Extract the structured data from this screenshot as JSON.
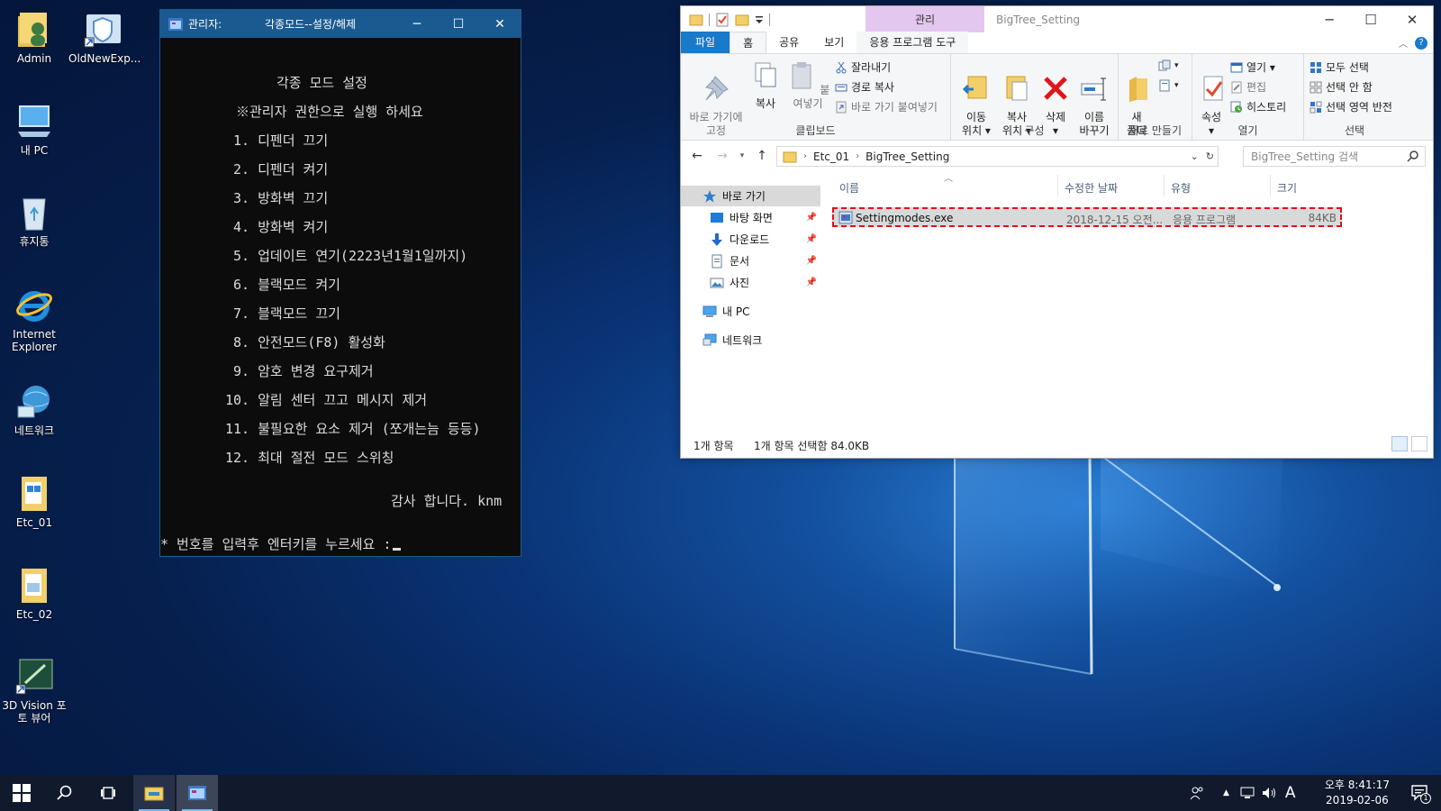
{
  "desktop": {
    "icons": [
      {
        "label": "Admin",
        "icon": "user-folder-icon"
      },
      {
        "label": "OldNewExp...",
        "icon": "shield-shortcut-icon"
      },
      {
        "label": "내 PC",
        "icon": "computer-icon"
      },
      {
        "label": "휴지통",
        "icon": "recycle-bin-icon"
      },
      {
        "label": "Internet Explorer",
        "icon": "internet-explorer-icon"
      },
      {
        "label": "네트워크",
        "icon": "network-icon"
      },
      {
        "label": "Etc_01",
        "icon": "folder-icon"
      },
      {
        "label": "Etc_02",
        "icon": "folder-icon"
      },
      {
        "label": "3D Vision 포토 뷰어",
        "icon": "3d-vision-icon"
      }
    ]
  },
  "console": {
    "title_admin": "관리자:",
    "title_main": "각종모드--설정/해제",
    "heading": "각종 모드 설정",
    "notice": "※관리자 권한으로 실행 하세요",
    "items": [
      "1. 디펜더 끄기",
      "2. 디펜더 켜기",
      "3. 방화벽 끄기",
      "4. 방화벽 켜기",
      "5. 업데이트 연기(2223년1월1일까지)",
      "6. 블랙모드 켜기",
      "7. 블랙모드 끄기",
      "8. 안전모드(F8) 활성화",
      "9. 암호 변경 요구제거",
      "10. 알림 센터 끄고 메시지 제거",
      "11. 불필요한 요소 제거 (쪼개는늠 등등)",
      "12. 최대 절전 모드 스위칭"
    ],
    "thanks": "감사 합니다. knm",
    "prompt": "* 번호를 입력후 엔터키를 누르세요 :"
  },
  "explorer": {
    "context_tab": "관리",
    "title": "BigTree_Setting",
    "tabs": {
      "file": "파일",
      "home": "홈",
      "share": "공유",
      "view": "보기",
      "app_tools": "응용 프로그램 도구"
    },
    "ribbon": {
      "pin_quick": "바로 가기에\n고정",
      "copy": "복사",
      "paste": "붙여넣기",
      "cut": "잘라내기",
      "copy_path": "경로 복사",
      "paste_shortcut": "바로 가기 붙여넣기",
      "clipboard": "클립보드",
      "move_to": "이동\n위치 ▾",
      "copy_to": "복사\n위치 ▾",
      "delete": "삭제\n▾",
      "rename": "이름\n바꾸기",
      "organize": "구성",
      "new_folder": "새\n폴더",
      "new": "새로 만들기",
      "properties": "속성\n▾",
      "open": "열기 ▾",
      "edit": "편집",
      "history": "히스토리",
      "open_group": "열기",
      "select_all": "모두 선택",
      "select_none": "선택 안 함",
      "invert_selection": "선택 영역 반전",
      "select_group": "선택"
    },
    "address": {
      "crumbs": [
        "Etc_01",
        "BigTree_Setting"
      ],
      "search_placeholder": "BigTree_Setting 검색"
    },
    "nav": {
      "quick_access": "바로 가기",
      "desktop": "바탕 화면",
      "downloads": "다운로드",
      "documents": "문서",
      "pictures": "사진",
      "this_pc": "내 PC",
      "network": "네트워크"
    },
    "columns": {
      "name": "이름",
      "modified": "수정한 날짜",
      "type": "유형",
      "size": "크기"
    },
    "files": [
      {
        "name": "Settingmodes.exe",
        "modified": "2018-12-15 오전...",
        "type": "응용 프로그램",
        "size": "84KB"
      }
    ],
    "status": {
      "count": "1개 항목",
      "selected": "1개 항목 선택함 84.0KB"
    }
  },
  "taskbar": {
    "clock_time": "오후 8:41:17",
    "clock_date": "2019-02-06",
    "ime": "A",
    "notification_count": "1"
  },
  "colors": {
    "title_blue": "#1a5a90",
    "file_tab_blue": "#1979ca",
    "selection_highlight": "#e0101a",
    "context_tab": "#e4c7ee"
  }
}
